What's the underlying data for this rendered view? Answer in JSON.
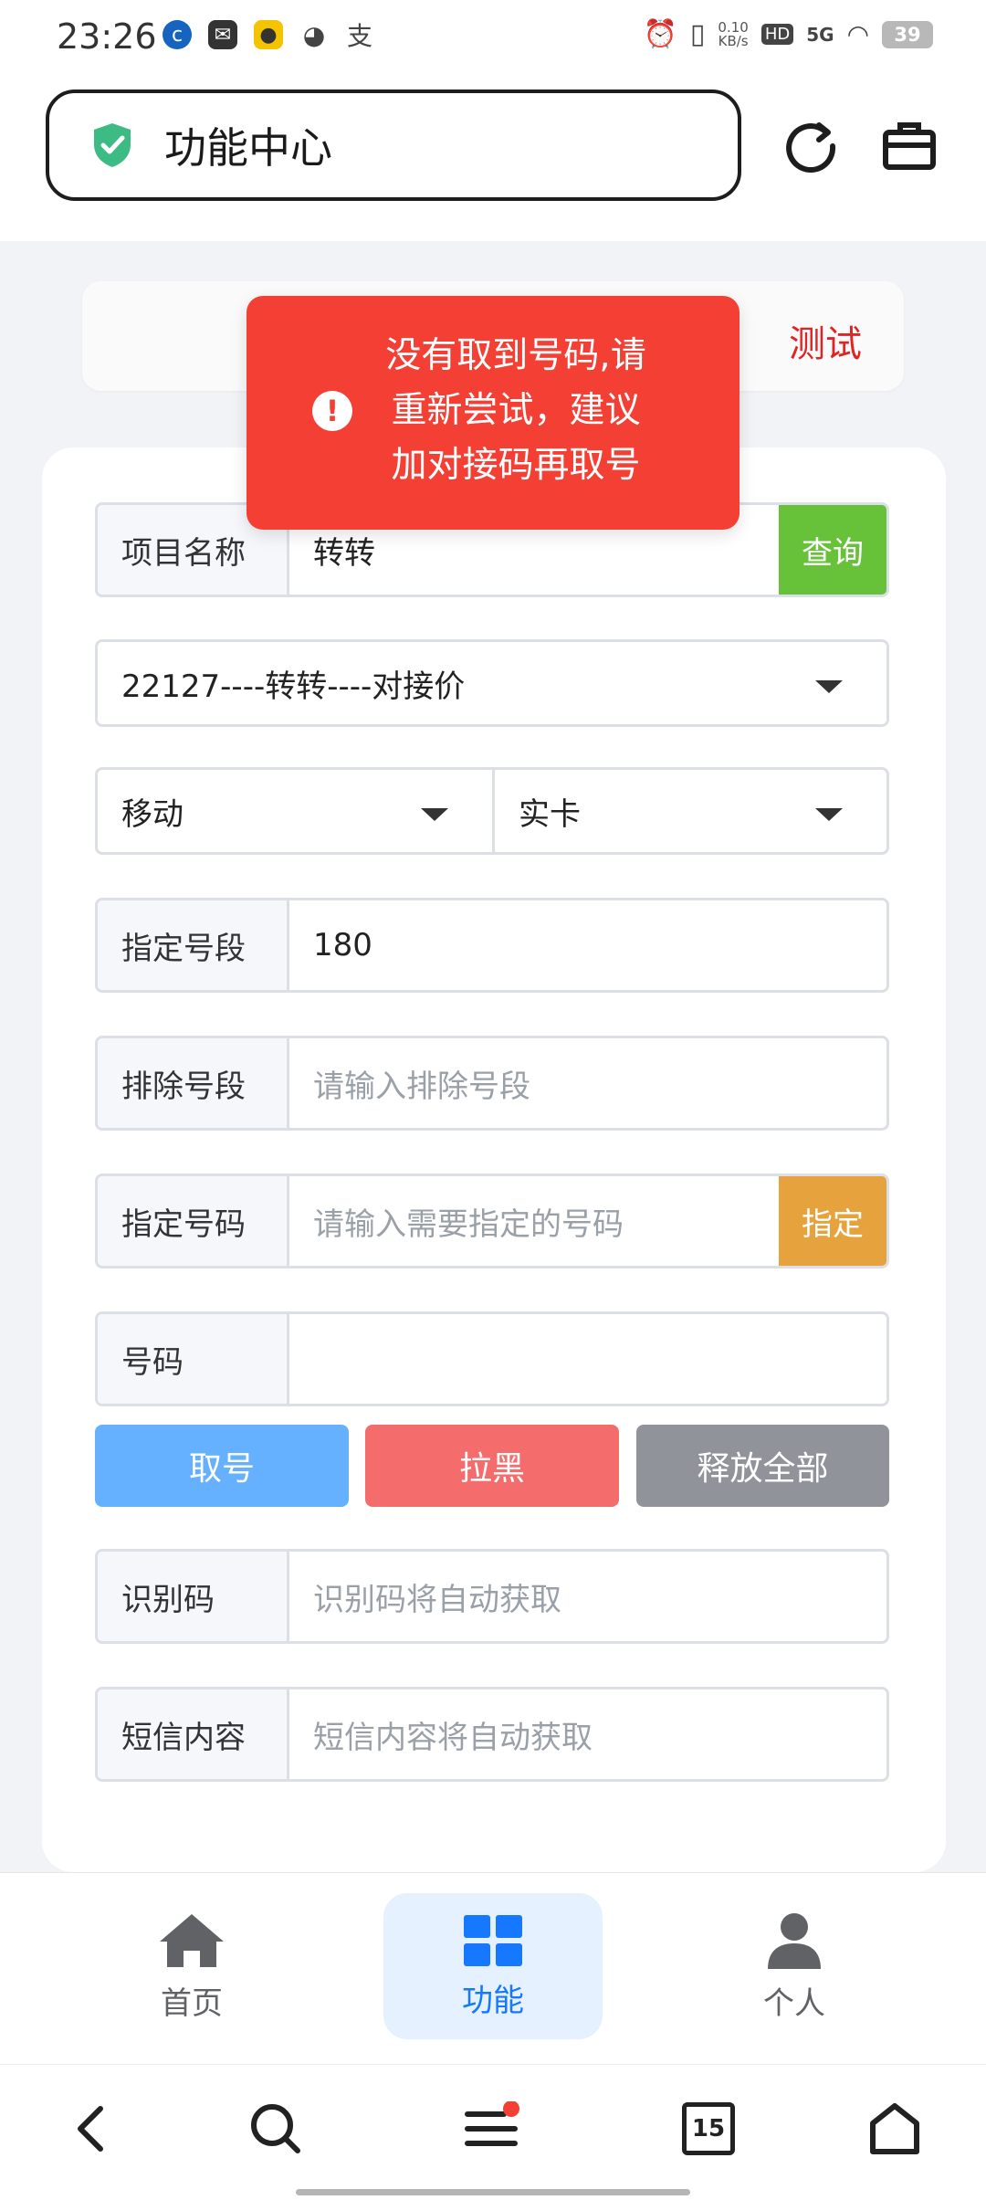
{
  "status": {
    "time": "23:26",
    "speed_value": "0.10",
    "speed_unit": "KB/s",
    "hd": "HD",
    "network": "5G",
    "battery": "39"
  },
  "header": {
    "title": "功能中心"
  },
  "test_card": {
    "label": "测试"
  },
  "toast": {
    "message": "没有取到号码,请重新尝试，建议加对接码再取号"
  },
  "form": {
    "project": {
      "label": "项目名称",
      "value": "转转",
      "button": "查询"
    },
    "project_select": {
      "value": "22127----转转----对接价"
    },
    "operator_select": {
      "value": "移动"
    },
    "card_select": {
      "value": "实卡"
    },
    "segment": {
      "label": "指定号段",
      "value": "180"
    },
    "exclude": {
      "label": "排除号段",
      "placeholder": "请输入排除号段"
    },
    "specify": {
      "label": "指定号码",
      "placeholder": "请输入需要指定的号码",
      "button": "指定"
    },
    "number": {
      "label": "号码",
      "value": ""
    },
    "actions": {
      "get": "取号",
      "block": "拉黑",
      "release_all": "释放全部"
    },
    "code": {
      "label": "识别码",
      "placeholder": "识别码将自动获取"
    },
    "sms": {
      "label": "短信内容",
      "placeholder": "短信内容将自动获取"
    }
  },
  "tabbar": {
    "items": [
      {
        "label": "首页",
        "icon": "home-icon"
      },
      {
        "label": "功能",
        "icon": "grid-icon",
        "active": true
      },
      {
        "label": "个人",
        "icon": "user-icon"
      }
    ]
  },
  "navbar": {
    "tabs_count": "15"
  },
  "colors": {
    "accent_blue": "#1677ff",
    "query_green": "#67c23a",
    "specify_orange": "#e6a23c",
    "get_blue": "#66b1ff",
    "block_red": "#f56c6c",
    "release_gray": "#909399",
    "toast_red": "#f43f34"
  }
}
